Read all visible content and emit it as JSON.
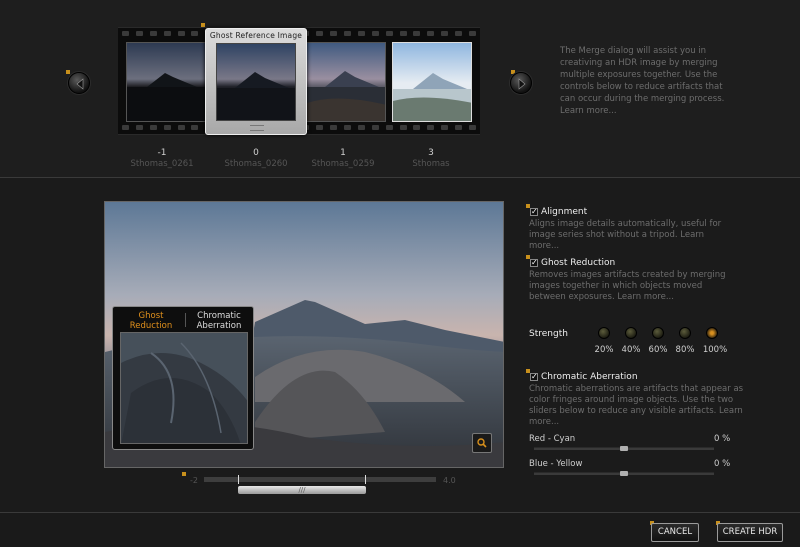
{
  "info": {
    "text": "The Merge dialog will assist you in creativing an HDR image by merging multiple exposures together. Use the controls below to reduce artifacts that can occur during the merging process. Learn more..."
  },
  "ghost_reference": {
    "title": "Ghost Reference Image"
  },
  "thumbnails": [
    {
      "ev": "-1",
      "file": "Sthomas_0261"
    },
    {
      "ev": "0",
      "file": "Sthomas_0260"
    },
    {
      "ev": "1",
      "file": "Sthomas_0259"
    },
    {
      "ev": "3",
      "file": "Sthomas"
    }
  ],
  "loupe": {
    "tab_active": "Ghost\nReduction",
    "tab_active_line1": "Ghost",
    "tab_active_line2": "Reduction",
    "tab_other_line1": "Chromatic",
    "tab_other_line2": "Aberration"
  },
  "ev_slider": {
    "min_label": "-2",
    "max_label": "4.0",
    "handle_label": "///"
  },
  "options": {
    "alignment": {
      "title": "Alignment",
      "desc": "Aligns image details automatically, useful for image series shot without a tripod. Learn more...",
      "checked": true
    },
    "ghost": {
      "title": "Ghost Reduction",
      "desc": "Removes images artifacts created by merging images together in which objects moved between exposures. Learn more...",
      "checked": true
    },
    "strength": {
      "label": "Strength",
      "levels": [
        "20%",
        "40%",
        "60%",
        "80%",
        "100%"
      ],
      "selected": "100%"
    },
    "chromatic": {
      "title": "Chromatic Aberration",
      "desc": "Chromatic aberrations are artifacts that appear as color fringes around image objects. Use the two sliders below to reduce any visible artifacts. Learn more...",
      "checked": true
    },
    "red_cyan": {
      "label": "Red - Cyan",
      "value": "0 %"
    },
    "blue_yellow": {
      "label": "Blue - Yellow",
      "value": "0 %"
    }
  },
  "buttons": {
    "cancel": "CANCEL",
    "create": "CREATE HDR"
  },
  "colors": {
    "accent": "#d8901c",
    "background": "#1b1b1b"
  },
  "icons": {
    "prev": "arrow-left-icon",
    "next": "arrow-right-icon",
    "zoom": "magnifier-icon"
  }
}
